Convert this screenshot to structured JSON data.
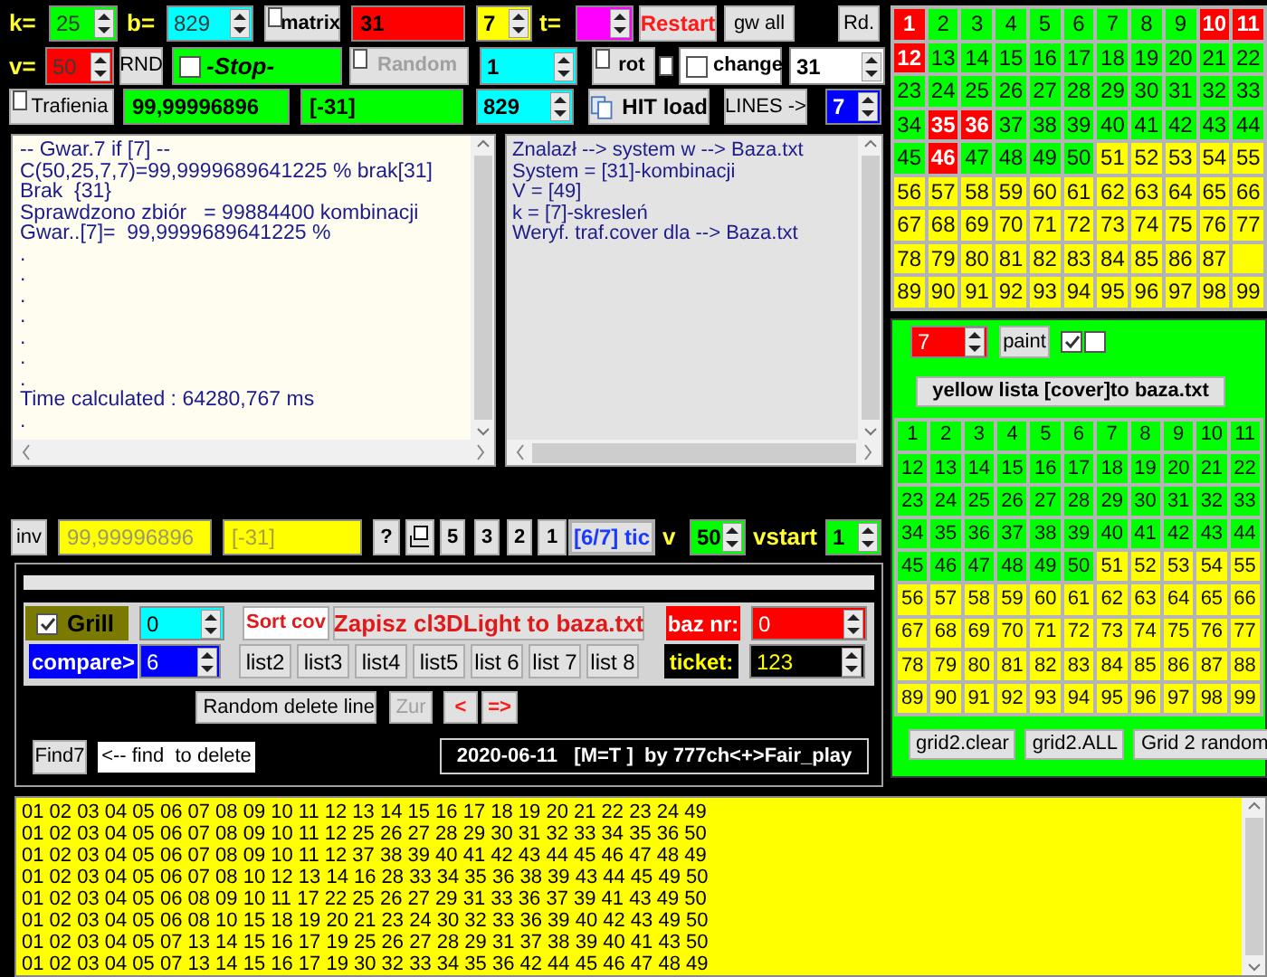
{
  "row1": [
    {
      "kind": "label",
      "text": "k="
    },
    {
      "kind": "spin",
      "value": "25",
      "color": "#00ff00",
      "disabled": true
    },
    {
      "kind": "label",
      "text": "b="
    },
    {
      "kind": "spin",
      "value": "829",
      "color": "#00ffff",
      "disabled": true
    },
    {
      "kind": "checkbutton",
      "label": "matrix",
      "checked": false
    },
    {
      "kind": "field",
      "value": "31",
      "color": "#ff0000"
    },
    {
      "kind": "spin",
      "value": "7",
      "color": "#ffff00",
      "disabled": false
    },
    {
      "kind": "label",
      "text": "t="
    },
    {
      "kind": "spin",
      "color": "#ff00ff"
    },
    {
      "kind": "button",
      "label": "Restart"
    },
    {
      "kind": "button",
      "label": "gw all"
    },
    {
      "kind": "button",
      "label": "Rd."
    }
  ],
  "row2": [
    {
      "kind": "label",
      "text": "v="
    },
    {
      "kind": "spin",
      "value": "50",
      "color": "#ff0000",
      "disabled": true
    },
    {
      "kind": "button",
      "label": "RND"
    },
    {
      "kind": "check",
      "label": "-Stop-",
      "checked": false,
      "color": "#00ff00"
    },
    {
      "kind": "checkbutton",
      "label": "Random",
      "checked": false,
      "disabled": true
    },
    {
      "kind": "spin",
      "value": "1",
      "color": "#00ffff",
      "disabled": false
    },
    {
      "kind": "checkbutton",
      "label": "rot",
      "checked": false
    },
    {
      "kind": "checkbox",
      "checked": false
    },
    {
      "kind": "check",
      "label": "change",
      "checked": false,
      "color": "#ffffff"
    },
    {
      "kind": "spin",
      "value": "31",
      "color": "#ffffff",
      "disabled": false
    }
  ],
  "row3": [
    {
      "kind": "checkbutton",
      "label": "Trafienia",
      "checked": false
    },
    {
      "kind": "field",
      "value": "99,99996896",
      "color": "#00ff00"
    },
    {
      "kind": "field",
      "value": "[-31]",
      "color": "#00ff00"
    },
    {
      "kind": "spin",
      "value": "829",
      "color": "#00ffff",
      "disabled": false
    },
    {
      "kind": "doc_button",
      "label": "HIT load"
    },
    {
      "kind": "button",
      "label": "LINES ->"
    },
    {
      "kind": "spin",
      "value": "7",
      "color": "#0000ff",
      "disabled": false
    }
  ],
  "log_left": {
    "lines": [
      "-- Gwar.7 if [7] --",
      "C(50,25,7,7)=99,9999689641225 % brak[31]",
      "Brak  {31}",
      "Sprawdzono zbiór   = 99884400 kombinacji",
      "Gwar..[7]=  99,9999689641225 %",
      ".",
      ".",
      ".",
      ".",
      ".",
      ".",
      ".",
      "Time calculated : 64280,767 ms",
      "."
    ]
  },
  "log_right": {
    "lines": [
      "Znalazł --> system w --> Baza.txt",
      "System = [31]-kombinacji",
      "V = [49]",
      "k = [7]-skresleń",
      "Weryf. traf.cover dla --> Baza.txt"
    ]
  },
  "row4": [
    {
      "kind": "button",
      "label": "inv"
    },
    {
      "kind": "field",
      "value": "99,99996896",
      "color": "#ffff00"
    },
    {
      "kind": "field",
      "value": "[-31]",
      "color": "#ffff00"
    },
    {
      "kind": "button",
      "label": "?"
    },
    {
      "kind": "icon_button"
    },
    {
      "kind": "button",
      "label": "5"
    },
    {
      "kind": "button",
      "label": "3"
    },
    {
      "kind": "button",
      "label": "2"
    },
    {
      "kind": "button",
      "label": "1"
    },
    {
      "kind": "button",
      "label": "[6/7] tic"
    },
    {
      "kind": "label",
      "text": "v"
    },
    {
      "kind": "spin",
      "value": "50",
      "color": "#00ff00",
      "disabled": false
    },
    {
      "kind": "label",
      "text": "vstart"
    },
    {
      "kind": "spin",
      "value": "1",
      "color": "#00ff00",
      "disabled": false
    }
  ],
  "panel": {
    "grill": {
      "label": "Grill",
      "checked": true
    },
    "grill_spin": "0",
    "sort_button": "Sort cov",
    "save_button": "Zapisz cl3DLight to baza.txt",
    "baz_label": "baz nr:",
    "baz_spin": "0",
    "compare_label": "compare>",
    "compare_spin": "6",
    "lists": [
      "list2",
      "list3",
      "list4",
      "list5",
      "list 6",
      "list 7",
      "list 8"
    ],
    "ticket_label": "ticket:",
    "ticket_spin": "123",
    "random_delete": "Random delete line",
    "zur": {
      "label": "Zur",
      "disabled": true
    },
    "prev": "<",
    "next": "=>",
    "find7": "Find7",
    "find_delete": "<-- find  to delete",
    "status": "2020-06-11   [M=T ]  by 777ch<+>Fair_play"
  },
  "grid1": {
    "cells": [
      {
        "n": "1",
        "color": "#ff0000"
      },
      {
        "n": "2",
        "color": "#00ff00"
      },
      {
        "n": "3",
        "color": "#00ff00"
      },
      {
        "n": "4",
        "color": "#00ff00"
      },
      {
        "n": "5",
        "color": "#00ff00"
      },
      {
        "n": "6",
        "color": "#00ff00"
      },
      {
        "n": "7",
        "color": "#00ff00"
      },
      {
        "n": "8",
        "color": "#00ff00"
      },
      {
        "n": "9",
        "color": "#00ff00"
      },
      {
        "n": "10",
        "color": "#ff0000"
      },
      {
        "n": "11",
        "color": "#ff0000"
      },
      {
        "n": "12",
        "color": "#ff0000"
      },
      {
        "n": "13",
        "color": "#00ff00"
      },
      {
        "n": "14",
        "color": "#00ff00"
      },
      {
        "n": "15",
        "color": "#00ff00"
      },
      {
        "n": "16",
        "color": "#00ff00"
      },
      {
        "n": "17",
        "color": "#00ff00"
      },
      {
        "n": "18",
        "color": "#00ff00"
      },
      {
        "n": "19",
        "color": "#00ff00"
      },
      {
        "n": "20",
        "color": "#00ff00"
      },
      {
        "n": "21",
        "color": "#00ff00"
      },
      {
        "n": "22",
        "color": "#00ff00"
      },
      {
        "n": "23",
        "color": "#00ff00"
      },
      {
        "n": "24",
        "color": "#00ff00"
      },
      {
        "n": "25",
        "color": "#00ff00"
      },
      {
        "n": "26",
        "color": "#00ff00"
      },
      {
        "n": "27",
        "color": "#00ff00"
      },
      {
        "n": "28",
        "color": "#00ff00"
      },
      {
        "n": "29",
        "color": "#00ff00"
      },
      {
        "n": "30",
        "color": "#00ff00"
      },
      {
        "n": "31",
        "color": "#00ff00"
      },
      {
        "n": "32",
        "color": "#00ff00"
      },
      {
        "n": "33",
        "color": "#00ff00"
      },
      {
        "n": "34",
        "color": "#00ff00"
      },
      {
        "n": "35",
        "color": "#ff0000"
      },
      {
        "n": "36",
        "color": "#ff0000"
      },
      {
        "n": "37",
        "color": "#00ff00"
      },
      {
        "n": "38",
        "color": "#00ff00"
      },
      {
        "n": "39",
        "color": "#00ff00"
      },
      {
        "n": "40",
        "color": "#00ff00"
      },
      {
        "n": "41",
        "color": "#00ff00"
      },
      {
        "n": "42",
        "color": "#00ff00"
      },
      {
        "n": "43",
        "color": "#00ff00"
      },
      {
        "n": "44",
        "color": "#00ff00"
      },
      {
        "n": "45",
        "color": "#00ff00"
      },
      {
        "n": "46",
        "color": "#ff0000"
      },
      {
        "n": "47",
        "color": "#00ff00"
      },
      {
        "n": "48",
        "color": "#00ff00"
      },
      {
        "n": "49",
        "color": "#00ff00"
      },
      {
        "n": "50",
        "color": "#00ff00"
      },
      {
        "n": "51",
        "color": "#ffff00"
      },
      {
        "n": "52",
        "color": "#ffff00"
      },
      {
        "n": "53",
        "color": "#ffff00"
      },
      {
        "n": "54",
        "color": "#ffff00"
      },
      {
        "n": "55",
        "color": "#ffff00"
      },
      {
        "n": "56",
        "color": "#ffff00"
      },
      {
        "n": "57",
        "color": "#ffff00"
      },
      {
        "n": "58",
        "color": "#ffff00"
      },
      {
        "n": "59",
        "color": "#ffff00"
      },
      {
        "n": "60",
        "color": "#ffff00"
      },
      {
        "n": "61",
        "color": "#ffff00"
      },
      {
        "n": "62",
        "color": "#ffff00"
      },
      {
        "n": "63",
        "color": "#ffff00"
      },
      {
        "n": "64",
        "color": "#ffff00"
      },
      {
        "n": "65",
        "color": "#ffff00"
      },
      {
        "n": "66",
        "color": "#ffff00"
      },
      {
        "n": "67",
        "color": "#ffff00"
      },
      {
        "n": "68",
        "color": "#ffff00"
      },
      {
        "n": "69",
        "color": "#ffff00"
      },
      {
        "n": "70",
        "color": "#ffff00"
      },
      {
        "n": "71",
        "color": "#ffff00"
      },
      {
        "n": "72",
        "color": "#ffff00"
      },
      {
        "n": "73",
        "color": "#ffff00"
      },
      {
        "n": "74",
        "color": "#ffff00"
      },
      {
        "n": "75",
        "color": "#ffff00"
      },
      {
        "n": "76",
        "color": "#ffff00"
      },
      {
        "n": "77",
        "color": "#ffff00"
      },
      {
        "n": "78",
        "color": "#ffff00"
      },
      {
        "n": "79",
        "color": "#ffff00"
      },
      {
        "n": "80",
        "color": "#ffff00"
      },
      {
        "n": "81",
        "color": "#ffff00"
      },
      {
        "n": "82",
        "color": "#ffff00"
      },
      {
        "n": "83",
        "color": "#ffff00"
      },
      {
        "n": "84",
        "color": "#ffff00"
      },
      {
        "n": "85",
        "color": "#ffff00"
      },
      {
        "n": "86",
        "color": "#ffff00"
      },
      {
        "n": "87",
        "color": "#ffff00"
      },
      {
        "color": "#ffff00"
      },
      {
        "n": "89",
        "color": "#ffff00"
      },
      {
        "n": "90",
        "color": "#ffff00"
      },
      {
        "n": "91",
        "color": "#ffff00"
      },
      {
        "n": "92",
        "color": "#ffff00"
      },
      {
        "n": "93",
        "color": "#ffff00"
      },
      {
        "n": "94",
        "color": "#ffff00"
      },
      {
        "n": "95",
        "color": "#ffff00"
      },
      {
        "n": "96",
        "color": "#ffff00"
      },
      {
        "n": "97",
        "color": "#ffff00"
      },
      {
        "n": "98",
        "color": "#ffff00"
      },
      {
        "n": "99",
        "color": "#ffff00"
      }
    ]
  },
  "grid2": {
    "count": "7",
    "paint": "paint",
    "checks": [
      {
        "checked": true
      },
      {
        "checked": false
      }
    ],
    "cover_button": "yellow lista [cover]to baza.txt",
    "cells": [
      {
        "n": "1",
        "color": "#00ff00"
      },
      {
        "n": "2",
        "color": "#00ff00"
      },
      {
        "n": "3",
        "color": "#00ff00"
      },
      {
        "n": "4",
        "color": "#00ff00"
      },
      {
        "n": "5",
        "color": "#00ff00"
      },
      {
        "n": "6",
        "color": "#00ff00"
      },
      {
        "n": "7",
        "color": "#00ff00"
      },
      {
        "n": "8",
        "color": "#00ff00"
      },
      {
        "n": "9",
        "color": "#00ff00"
      },
      {
        "n": "10",
        "color": "#00ff00"
      },
      {
        "n": "11",
        "color": "#00ff00"
      },
      {
        "n": "12",
        "color": "#00ff00"
      },
      {
        "n": "13",
        "color": "#00ff00"
      },
      {
        "n": "14",
        "color": "#00ff00"
      },
      {
        "n": "15",
        "color": "#00ff00"
      },
      {
        "n": "16",
        "color": "#00ff00"
      },
      {
        "n": "17",
        "color": "#00ff00"
      },
      {
        "n": "18",
        "color": "#00ff00"
      },
      {
        "n": "19",
        "color": "#00ff00"
      },
      {
        "n": "20",
        "color": "#00ff00"
      },
      {
        "n": "21",
        "color": "#00ff00"
      },
      {
        "n": "22",
        "color": "#00ff00"
      },
      {
        "n": "23",
        "color": "#00ff00"
      },
      {
        "n": "24",
        "color": "#00ff00"
      },
      {
        "n": "25",
        "color": "#00ff00"
      },
      {
        "n": "26",
        "color": "#00ff00"
      },
      {
        "n": "27",
        "color": "#00ff00"
      },
      {
        "n": "28",
        "color": "#00ff00"
      },
      {
        "n": "29",
        "color": "#00ff00"
      },
      {
        "n": "30",
        "color": "#00ff00"
      },
      {
        "n": "31",
        "color": "#00ff00"
      },
      {
        "n": "32",
        "color": "#00ff00"
      },
      {
        "n": "33",
        "color": "#00ff00"
      },
      {
        "n": "34",
        "color": "#00ff00"
      },
      {
        "n": "35",
        "color": "#00ff00"
      },
      {
        "n": "36",
        "color": "#00ff00"
      },
      {
        "n": "37",
        "color": "#00ff00"
      },
      {
        "n": "38",
        "color": "#00ff00"
      },
      {
        "n": "39",
        "color": "#00ff00"
      },
      {
        "n": "40",
        "color": "#00ff00"
      },
      {
        "n": "41",
        "color": "#00ff00"
      },
      {
        "n": "42",
        "color": "#00ff00"
      },
      {
        "n": "43",
        "color": "#00ff00"
      },
      {
        "n": "44",
        "color": "#00ff00"
      },
      {
        "n": "45",
        "color": "#00ff00"
      },
      {
        "n": "46",
        "color": "#00ff00"
      },
      {
        "n": "47",
        "color": "#00ff00"
      },
      {
        "n": "48",
        "color": "#00ff00"
      },
      {
        "n": "49",
        "color": "#00ff00"
      },
      {
        "n": "50",
        "color": "#00ff00"
      },
      {
        "n": "51",
        "color": "#ffff00"
      },
      {
        "n": "52",
        "color": "#ffff00"
      },
      {
        "n": "53",
        "color": "#ffff00"
      },
      {
        "n": "54",
        "color": "#ffff00"
      },
      {
        "n": "55",
        "color": "#ffff00"
      },
      {
        "n": "56",
        "color": "#ffff00"
      },
      {
        "n": "57",
        "color": "#ffff00"
      },
      {
        "n": "58",
        "color": "#ffff00"
      },
      {
        "n": "59",
        "color": "#ffff00"
      },
      {
        "n": "60",
        "color": "#ffff00"
      },
      {
        "n": "61",
        "color": "#ffff00"
      },
      {
        "n": "62",
        "color": "#ffff00"
      },
      {
        "n": "63",
        "color": "#ffff00"
      },
      {
        "n": "64",
        "color": "#ffff00"
      },
      {
        "n": "65",
        "color": "#ffff00"
      },
      {
        "n": "66",
        "color": "#ffff00"
      },
      {
        "n": "67",
        "color": "#ffff00"
      },
      {
        "n": "68",
        "color": "#ffff00"
      },
      {
        "n": "69",
        "color": "#ffff00"
      },
      {
        "n": "70",
        "color": "#ffff00"
      },
      {
        "n": "71",
        "color": "#ffff00"
      },
      {
        "n": "72",
        "color": "#ffff00"
      },
      {
        "n": "73",
        "color": "#ffff00"
      },
      {
        "n": "74",
        "color": "#ffff00"
      },
      {
        "n": "75",
        "color": "#ffff00"
      },
      {
        "n": "76",
        "color": "#ffff00"
      },
      {
        "n": "77",
        "color": "#ffff00"
      },
      {
        "n": "78",
        "color": "#ffff00"
      },
      {
        "n": "79",
        "color": "#ffff00"
      },
      {
        "n": "80",
        "color": "#ffff00"
      },
      {
        "n": "81",
        "color": "#ffff00"
      },
      {
        "n": "82",
        "color": "#ffff00"
      },
      {
        "n": "83",
        "color": "#ffff00"
      },
      {
        "n": "84",
        "color": "#ffff00"
      },
      {
        "n": "85",
        "color": "#ffff00"
      },
      {
        "n": "86",
        "color": "#ffff00"
      },
      {
        "n": "87",
        "color": "#ffff00"
      },
      {
        "n": "88",
        "color": "#ffff00"
      },
      {
        "n": "89",
        "color": "#ffff00"
      },
      {
        "n": "90",
        "color": "#ffff00"
      },
      {
        "n": "91",
        "color": "#ffff00"
      },
      {
        "n": "92",
        "color": "#ffff00"
      },
      {
        "n": "93",
        "color": "#ffff00"
      },
      {
        "n": "94",
        "color": "#ffff00"
      },
      {
        "n": "95",
        "color": "#ffff00"
      },
      {
        "n": "96",
        "color": "#ffff00"
      },
      {
        "n": "97",
        "color": "#ffff00"
      },
      {
        "n": "98",
        "color": "#ffff00"
      },
      {
        "n": "99",
        "color": "#ffff00"
      }
    ],
    "buttons": [
      "grid2.clear",
      "grid2.ALL",
      "Grid 2 random"
    ]
  },
  "output": {
    "lines": [
      "01 02 03 04 05 06 07 08 09 10 11 12 13 14 15 16 17 18 19 20 21 22 23 24 49",
      "01 02 03 04 05 06 07 08 09 10 11 12 25 26 27 28 29 30 31 32 33 34 35 36 50",
      "01 02 03 04 05 06 07 08 09 10 11 12 37 38 39 40 41 42 43 44 45 46 47 48 49",
      "01 02 03 04 05 06 07 08 10 12 13 14 16 28 33 34 35 36 38 39 43 44 45 49 50",
      "01 02 03 04 05 06 08 09 10 11 17 22 25 26 27 29 31 33 36 37 39 41 43 49 50",
      "01 02 03 04 05 06 08 10 15 18 19 20 21 23 24 30 32 33 36 39 40 42 43 49 50",
      "01 02 03 04 05 07 13 14 15 16 17 19 25 26 27 28 29 31 37 38 39 40 41 43 50",
      "01 02 03 04 05 07 13 14 15 16 17 19 30 32 33 34 35 36 42 44 45 46 47 48 49"
    ]
  }
}
